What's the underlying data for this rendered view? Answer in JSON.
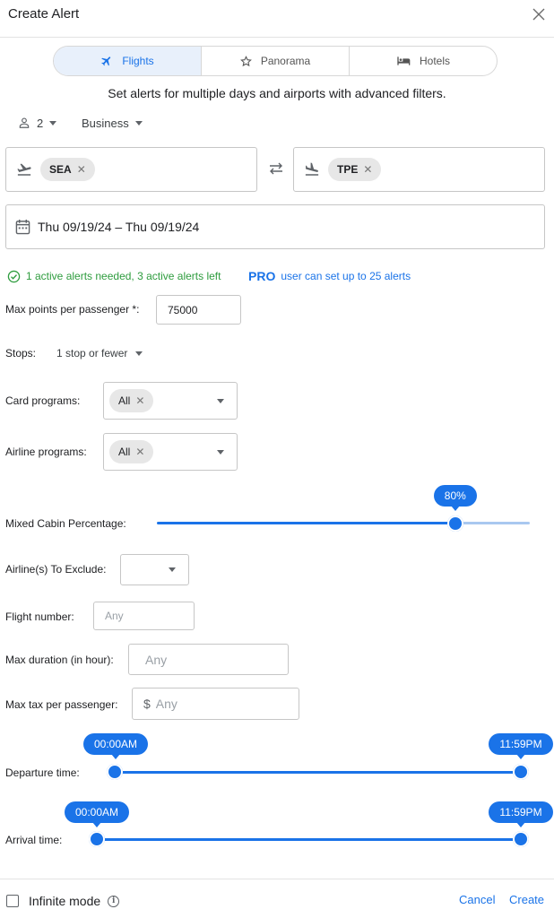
{
  "header": {
    "title": "Create Alert"
  },
  "tabs": [
    {
      "label": "Flights",
      "icon": "airplane-icon",
      "active": true
    },
    {
      "label": "Panorama",
      "icon": "star-icon",
      "active": false
    },
    {
      "label": "Hotels",
      "icon": "bed-icon",
      "active": false
    }
  ],
  "subtitle": "Set alerts for multiple days and airports with advanced filters.",
  "passengers": {
    "count": "2",
    "cabin": "Business"
  },
  "origin": {
    "chips": [
      "SEA"
    ]
  },
  "destination": {
    "chips": [
      "TPE"
    ]
  },
  "dates": {
    "value": "Thu 09/19/24 – Thu 09/19/24"
  },
  "status": {
    "message": "1 active alerts needed, 3 active alerts left",
    "pro_badge": "PRO",
    "pro_message": "user can set up to 25 alerts"
  },
  "filters": {
    "max_points_label": "Max points per passenger *:",
    "max_points_value": "75000",
    "stops_label": "Stops:",
    "stops_value": "1 stop or fewer",
    "card_programs_label": "Card programs:",
    "card_programs_chip": "All",
    "airline_programs_label": "Airline programs:",
    "airline_programs_chip": "All",
    "mixed_cabin_label": "Mixed Cabin Percentage:",
    "mixed_cabin_value": 80,
    "mixed_cabin_tip": "80%",
    "exclude_label": "Airline(s) To Exclude:",
    "flight_number_label": "Flight number:",
    "flight_number_placeholder": "Any",
    "max_duration_label": "Max duration (in hour):",
    "max_duration_placeholder": "Any",
    "max_tax_label": "Max tax per passenger:",
    "max_tax_currency": "$",
    "max_tax_placeholder": "Any"
  },
  "departure": {
    "label": "Departure time:",
    "start": "00:00AM",
    "end": "11:59PM"
  },
  "arrival": {
    "label": "Arrival time:",
    "start": "00:00AM",
    "end": "11:59PM"
  },
  "footer": {
    "infinite_label": "Infinite mode",
    "cancel_label": "Cancel",
    "create_label": "Create"
  },
  "colors": {
    "accent": "#1a73e8",
    "success": "#2e9c3e",
    "track_rest": "#a9c8f0"
  }
}
